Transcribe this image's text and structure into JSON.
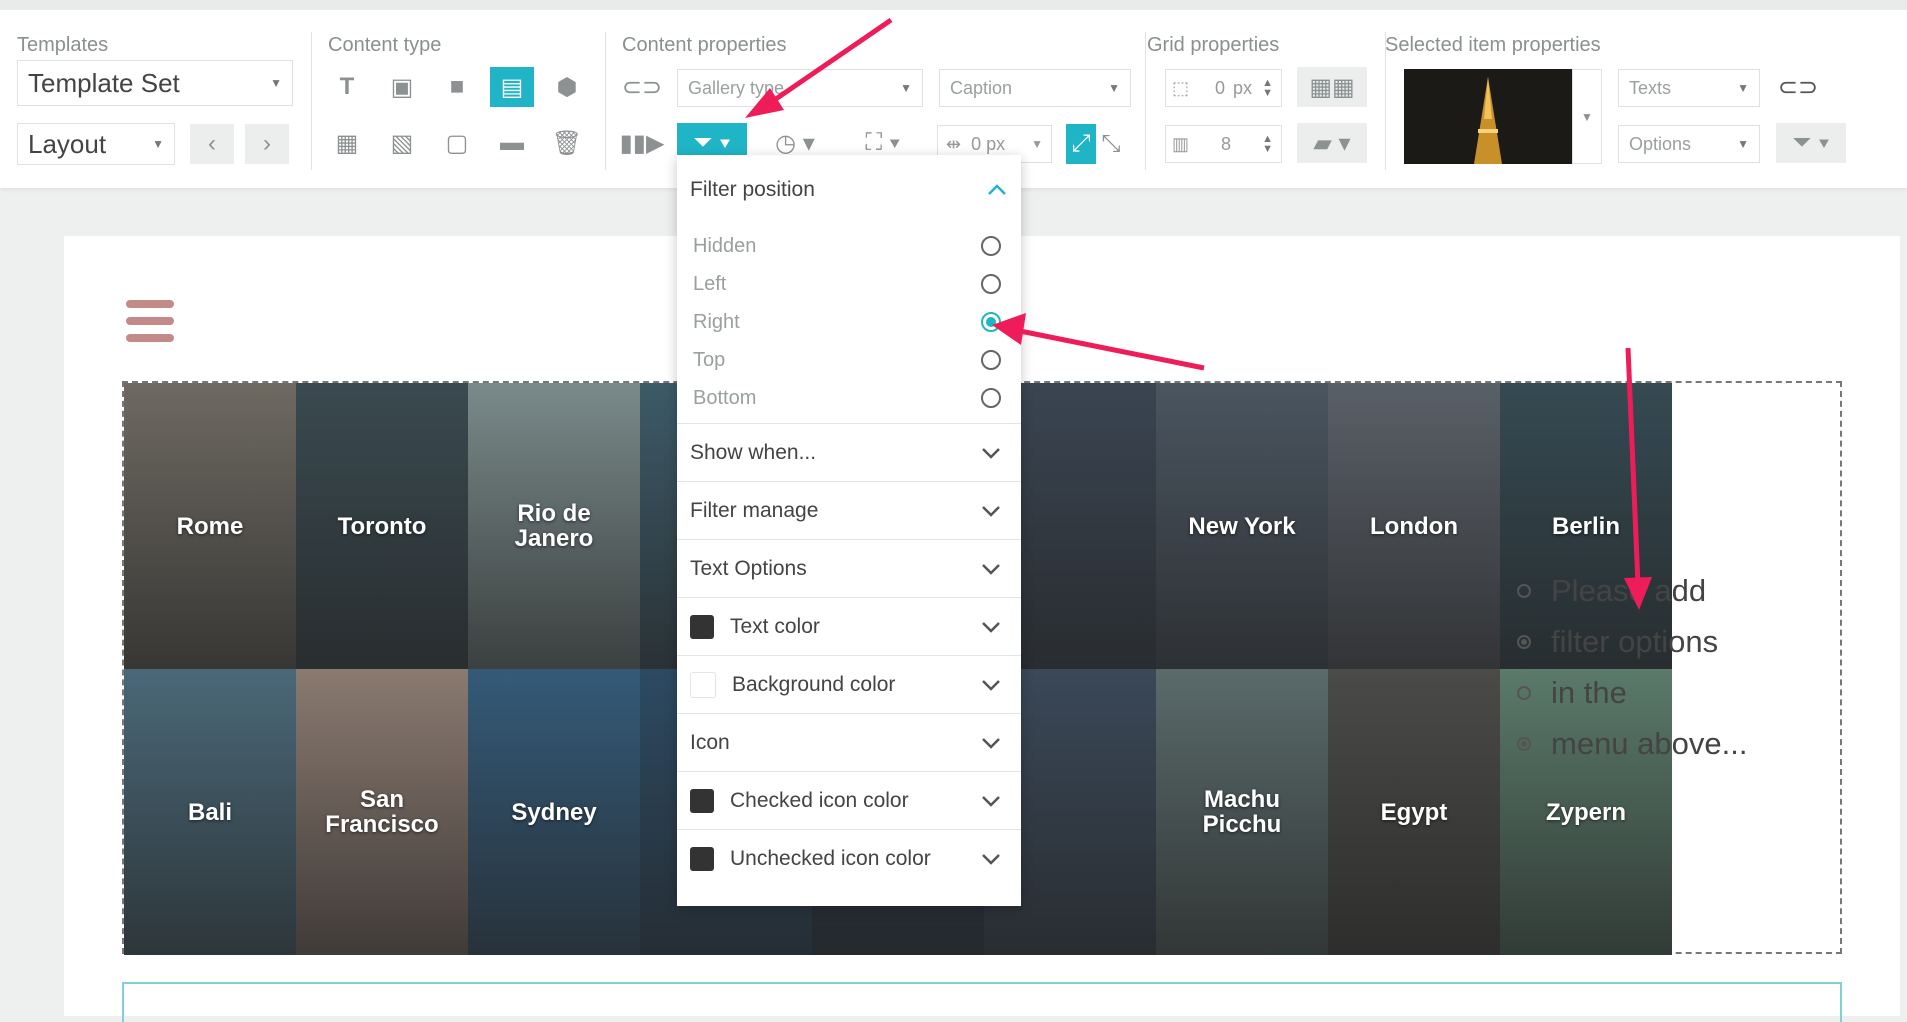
{
  "toolbar": {
    "templates": {
      "label": "Templates",
      "template_set": "Template Set",
      "layout": "Layout"
    },
    "content_type": {
      "label": "Content type"
    },
    "content_properties": {
      "label": "Content properties",
      "gallery_type_placeholder": "Gallery type",
      "caption": "Caption",
      "gap_value": "0 px"
    },
    "grid_properties": {
      "label": "Grid properties",
      "padding_value": "0",
      "padding_unit": "px",
      "columns_value": "8"
    },
    "selected_item": {
      "label": "Selected item properties",
      "texts": "Texts",
      "options": "Options"
    }
  },
  "filter_dropdown": {
    "title": "Filter position",
    "options": [
      {
        "label": "Hidden",
        "checked": false
      },
      {
        "label": "Left",
        "checked": false
      },
      {
        "label": "Right",
        "checked": true
      },
      {
        "label": "Top",
        "checked": false
      },
      {
        "label": "Bottom",
        "checked": false
      }
    ],
    "sections": [
      {
        "label": "Show when..."
      },
      {
        "label": "Filter manage"
      },
      {
        "label": "Text Options"
      },
      {
        "label": "Text color",
        "swatch": "#333333"
      },
      {
        "label": "Background color",
        "swatch": "#ffffff"
      },
      {
        "label": "Icon"
      },
      {
        "label": "Checked icon color",
        "swatch": "#333333"
      },
      {
        "label": "Unchecked icon color",
        "swatch": "#333333"
      }
    ]
  },
  "gallery": {
    "tiles": [
      {
        "label": "Rome",
        "color": "#6e6a62"
      },
      {
        "label": "Toronto",
        "color": "#3a4a50"
      },
      {
        "label": "Rio de Janero",
        "color": "#7a8a8a"
      },
      {
        "label": "",
        "color": "#3d5a68"
      },
      {
        "label": "",
        "color": "#2f4450"
      },
      {
        "label": "",
        "color": "#3a4552"
      },
      {
        "label": "New York",
        "color": "#4a5560"
      },
      {
        "label": "London",
        "color": "#5a6068"
      },
      {
        "label": "Berlin",
        "color": "#354a52"
      },
      {
        "label": "Bali",
        "color": "#4a6878"
      },
      {
        "label": "San Francisco",
        "color": "#8a7a70"
      },
      {
        "label": "Sydney",
        "color": "#345a78"
      },
      {
        "label": "",
        "color": "#2d4a62"
      },
      {
        "label": "",
        "color": "#2a3a4a"
      },
      {
        "label": "",
        "color": "#3a4858"
      },
      {
        "label": "Machu Picchu",
        "color": "#5a6a6a"
      },
      {
        "label": "Egypt",
        "color": "#4a4a48"
      },
      {
        "label": "Zypern",
        "color": "#5a7a6a"
      }
    ],
    "filter_hint": [
      {
        "text": "Please add",
        "filled": false
      },
      {
        "text": "filter options",
        "filled": true
      },
      {
        "text": "in the",
        "filled": false
      },
      {
        "text": "menu above...",
        "filled": true
      }
    ]
  },
  "colors": {
    "accent": "#1fb5c7",
    "arrow": "#ee1d5a",
    "hamburger": "#c48a88"
  }
}
